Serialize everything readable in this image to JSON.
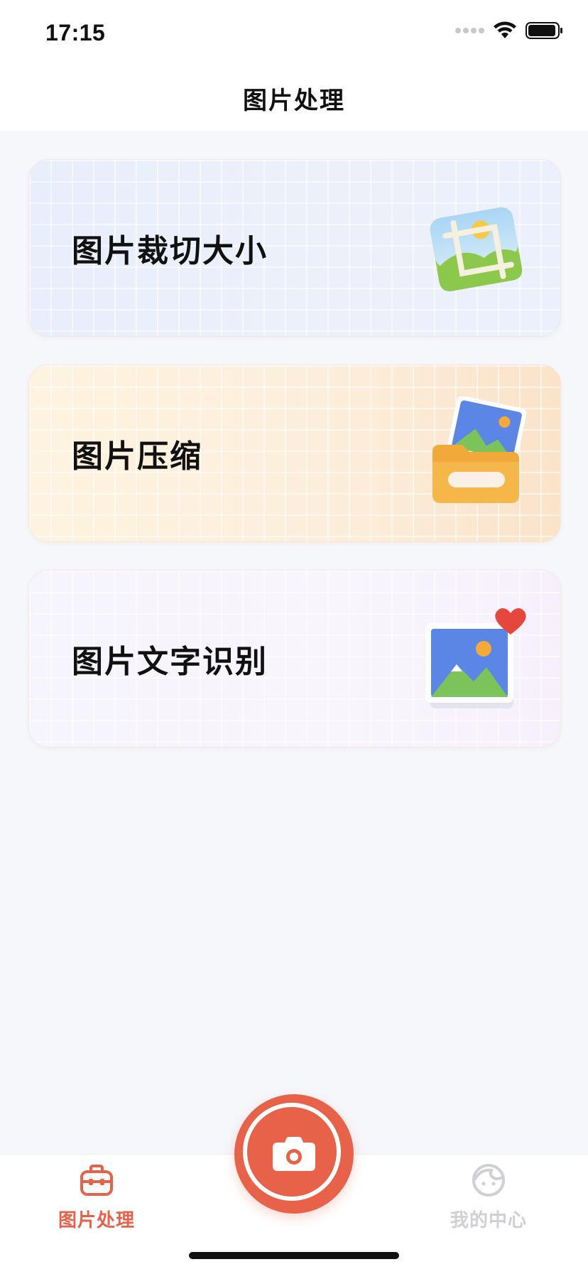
{
  "status_bar": {
    "time": "17:15",
    "signal_icon": "signal-dots-icon",
    "wifi_icon": "wifi-icon",
    "battery_icon": "battery-icon"
  },
  "nav": {
    "title": "图片处理"
  },
  "cards": [
    {
      "label": "图片裁切大小",
      "icon": "crop-image-icon"
    },
    {
      "label": "图片压缩",
      "icon": "folder-image-icon"
    },
    {
      "label": "图片文字识别",
      "icon": "photo-heart-icon"
    }
  ],
  "tab_bar": {
    "home_label": "图片处理",
    "home_icon": "toolbox-icon",
    "camera_icon": "camera-icon",
    "profile_label": "我的中心",
    "profile_icon": "face-icon"
  },
  "colors": {
    "accent": "#E8624A",
    "inactive": "#CFCFD4",
    "background": "#F6F7FB"
  }
}
